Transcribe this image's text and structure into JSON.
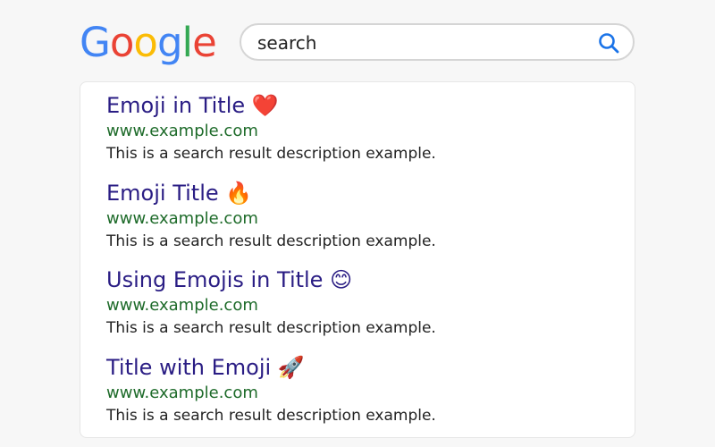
{
  "logo": {
    "letters": [
      "G",
      "o",
      "o",
      "g",
      "l",
      "e"
    ],
    "colors": [
      "#4285F4",
      "#EA4335",
      "#FBBC05",
      "#4285F4",
      "#34A853",
      "#EA4335"
    ]
  },
  "search": {
    "value": "search",
    "icon": "search-icon",
    "icon_color": "#1a73e8"
  },
  "results": [
    {
      "title": "Emoji in Title ❤️",
      "url": "www.example.com",
      "description": "This is a search result description example."
    },
    {
      "title": "Emoji Title 🔥",
      "url": "www.example.com",
      "description": "This is a search result description example."
    },
    {
      "title": "Using Emojis in Title 😊",
      "url": "www.example.com",
      "description": "This is a search result description example."
    },
    {
      "title": "Title with Emoji 🚀",
      "url": "www.example.com",
      "description": "This is a search result description example."
    }
  ],
  "colors": {
    "title": "#2a1d84",
    "url": "#1e6b2a",
    "description": "#222222"
  }
}
